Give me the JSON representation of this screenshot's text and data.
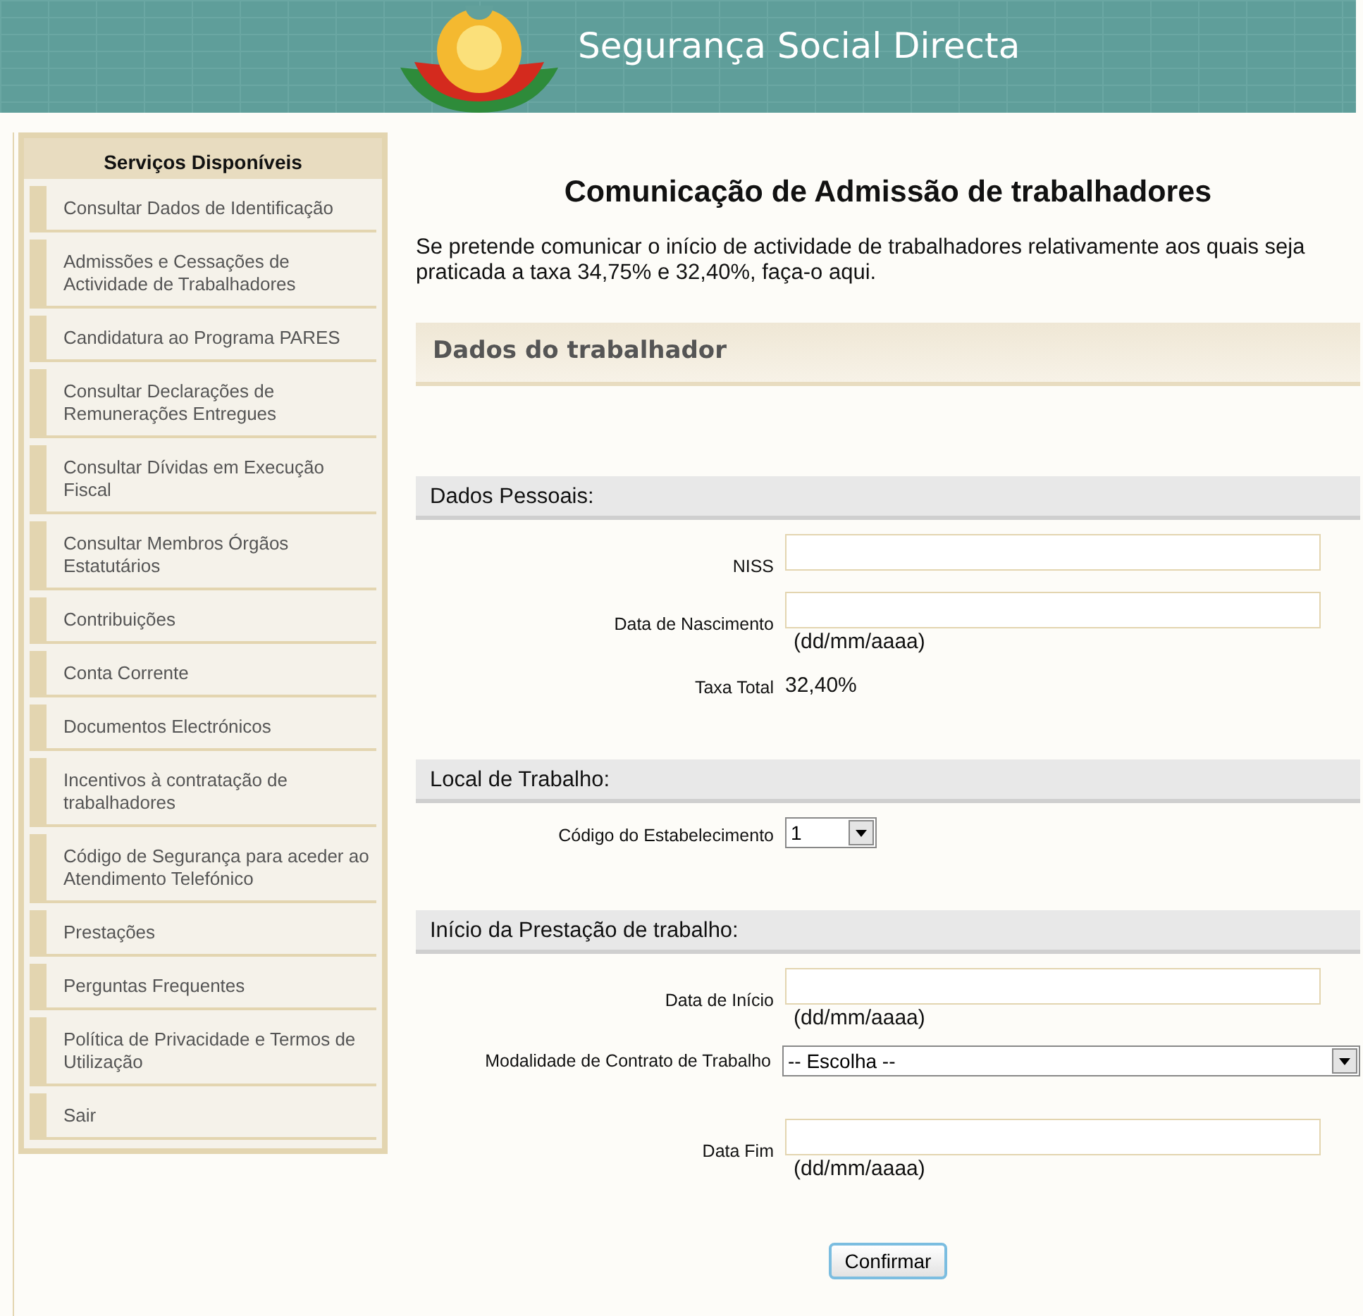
{
  "header": {
    "title": "Segurança Social Directa"
  },
  "sidebar": {
    "title": "Serviços Disponíveis",
    "items": [
      {
        "label": "Consultar Dados de Identificação"
      },
      {
        "label": "Admissões e Cessações de Actividade de Trabalhadores"
      },
      {
        "label": "Candidatura ao Programa PARES"
      },
      {
        "label": "Consultar Declarações de Remunerações Entregues"
      },
      {
        "label": "Consultar Dívidas em Execução Fiscal"
      },
      {
        "label": "Consultar Membros Órgãos Estatutários"
      },
      {
        "label": "Contribuições"
      },
      {
        "label": "Conta Corrente"
      },
      {
        "label": "Documentos Electrónicos"
      },
      {
        "label": "Incentivos à contratação de trabalhadores"
      },
      {
        "label": "Código de Segurança para aceder ao Atendimento Telefónico"
      },
      {
        "label": "Prestações"
      },
      {
        "label": "Perguntas Frequentes"
      },
      {
        "label": "Política de Privacidade e Termos de Utilização"
      },
      {
        "label": "Sair"
      }
    ]
  },
  "main": {
    "title": "Comunicação de Admissão de trabalhadores",
    "intro": "Se pretende comunicar o início de actividade de trabalhadores relativamente aos quais seja praticada a taxa 34,75% e 32,40%, faça-o aqui.",
    "panel_title": "Dados do trabalhador",
    "sections": [
      {
        "title": "Dados Pessoais:",
        "fields": [
          {
            "kind": "input",
            "label": "NISS"
          },
          {
            "kind": "input",
            "label": "Data de Nascimento",
            "hint": "(dd/mm/aaaa)"
          },
          {
            "kind": "value",
            "label": "Taxa Total",
            "value": "32,40%"
          }
        ]
      },
      {
        "title": "Local de Trabalho:",
        "fields": [
          {
            "kind": "dropdown",
            "label": "Código do Estabelecimento",
            "value": "1"
          }
        ]
      },
      {
        "title": "Início da Prestação de trabalho:",
        "fields": [
          {
            "kind": "input",
            "label": "Data de Início",
            "hint": "(dd/mm/aaaa)"
          },
          {
            "kind": "wide-dropdown",
            "label": "Modalidade de Contrato de Trabalho",
            "value": "-- Escolha --"
          },
          {
            "kind": "input",
            "label": "Data Fim",
            "hint": "(dd/mm/aaaa)"
          }
        ]
      }
    ],
    "button": "Confirmar"
  }
}
